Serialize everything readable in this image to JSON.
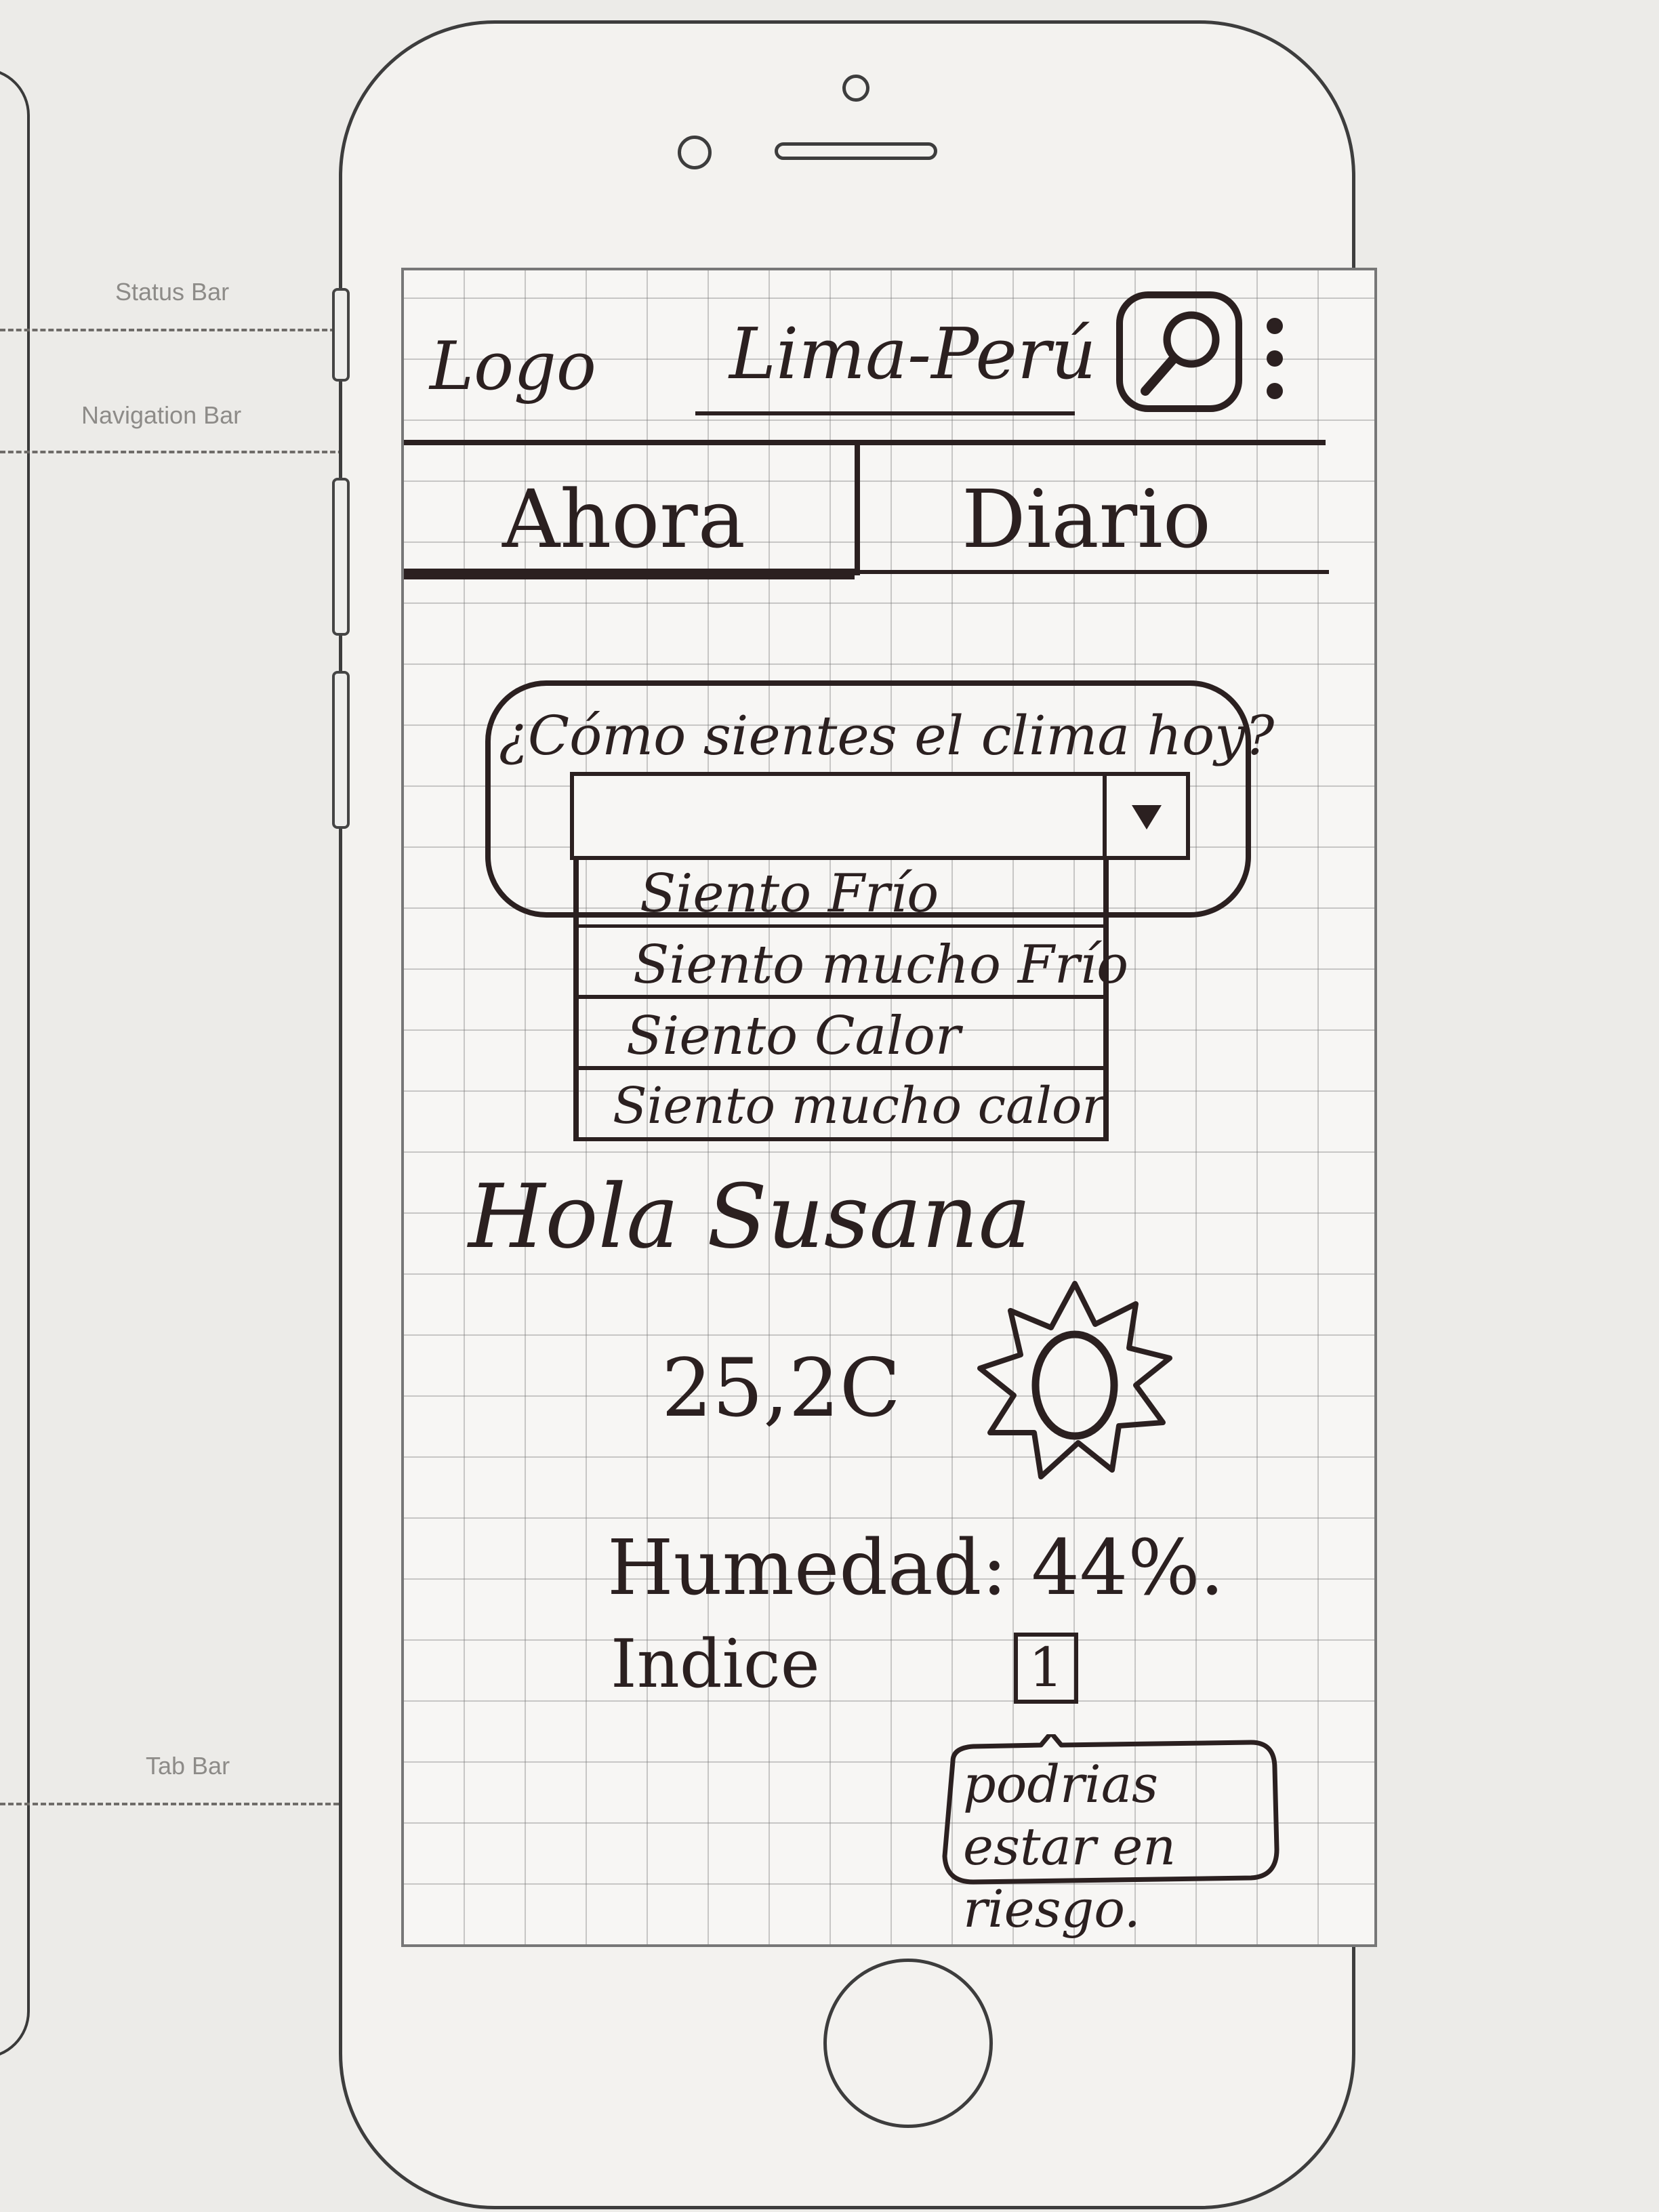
{
  "guides": {
    "status_bar": "Status Bar",
    "navigation_bar": "Navigation Bar",
    "tab_bar": "Tab Bar"
  },
  "header": {
    "logo": "Logo",
    "location": "Lima-Perú",
    "search_icon": "search-icon",
    "menu_icon": "more-vertical-icon"
  },
  "tabs": [
    {
      "label": "Ahora",
      "selected": true
    },
    {
      "label": "Diario",
      "selected": false
    }
  ],
  "feeling": {
    "question": "¿Cómo sientes el clima hoy?",
    "selected_value": "",
    "dropdown_icon": "triangle-down-icon",
    "options": [
      "Siento Frío",
      "Siento mucho Frío",
      "Siento Calor",
      "Siento mucho calor"
    ]
  },
  "greeting": "Hola Susana",
  "weather": {
    "temperature": "25,2C",
    "icon": "sun-icon",
    "humidity": "Humedad: 44%.",
    "index_label": "Indice",
    "index_value": "1",
    "tooltip": "podrias estar en riesgo."
  },
  "colors": {
    "ink": "#2b2020",
    "paper": "#f7f6f4",
    "grid": "#8a8a8a"
  }
}
